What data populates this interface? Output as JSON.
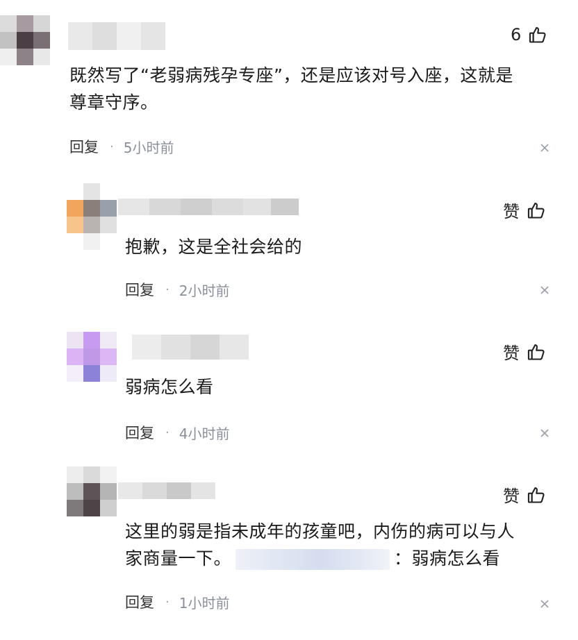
{
  "comments": [
    {
      "likes": "6",
      "text_lines": [
        "既然写了“老弱病残孕专座”，还是应该对号入座，这就是",
        "尊章守序。"
      ],
      "reply_label": "回复",
      "time": "5小时前"
    }
  ],
  "replies": [
    {
      "likes": "赞",
      "text_lines": [
        "抱歉，这是全社会给的"
      ],
      "reply_label": "回复",
      "time": "2小时前"
    },
    {
      "likes": "赞",
      "text_lines": [
        "弱病怎么看"
      ],
      "reply_label": "回复",
      "time": "4小时前"
    },
    {
      "likes": "赞",
      "text_line1": "这里的弱是指未成年的孩童吧，内伤的病可以与人",
      "text_line2_before": "家商量一下。",
      "text_line2_after": "：弱病怎么看",
      "reply_label": "回复",
      "time": "1小时前"
    }
  ],
  "icons": {
    "like": "thumbs-up-icon",
    "close": "close-icon",
    "separator": "·"
  }
}
